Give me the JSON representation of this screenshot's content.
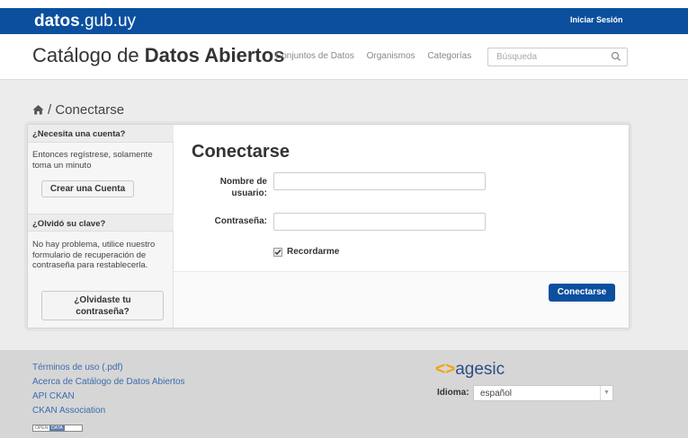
{
  "topbar": {
    "brand_bold": "datos",
    "brand_rest": ".gub.uy",
    "login_label": "Iniciar Sesión"
  },
  "header": {
    "title_plain": "Catálogo de",
    "title_bold": "Datos Abiertos",
    "nav": [
      "Conjuntos de Datos",
      "Organismos",
      "Categorías"
    ],
    "search_placeholder": "Búsqueda"
  },
  "breadcrumb": {
    "separator": "/",
    "current": "Conectarse"
  },
  "sidebar": {
    "account_heading": "¿Necesita una cuenta?",
    "account_text": "Entonces regístrese, solamente toma un minuto",
    "create_button": "Crear una Cuenta",
    "forgot_heading": "¿Olvidó su clave?",
    "forgot_text": "No hay problema, utilice nuestro formulario de recuperación de contraseña para restablecerla.",
    "forgot_button_line1": "¿Olvidaste tu",
    "forgot_button_line2": "contraseña?"
  },
  "form": {
    "title": "Conectarse",
    "username_label_line1": "Nombre de",
    "username_label_line2": "usuario:",
    "username_value": "",
    "password_label": "Contraseña:",
    "password_value": "",
    "remember_label": "Recordarme",
    "remember_checked": true,
    "submit_label": "Conectarse"
  },
  "footer": {
    "links": [
      "Términos de uso (.pdf)",
      "Acerca de Catálogo de Datos Abiertos",
      "API CKAN",
      "CKAN Association"
    ],
    "badge_open": "OPEN",
    "badge_data": "DATA",
    "agesic_arrow": "<>",
    "agesic_name": "agesic",
    "language_label": "Idioma:",
    "language_value": "español"
  },
  "colors": {
    "brand_blue": "#0b4f9e",
    "link_blue": "#3b6cad",
    "agesic_orange": "#f2a400"
  }
}
